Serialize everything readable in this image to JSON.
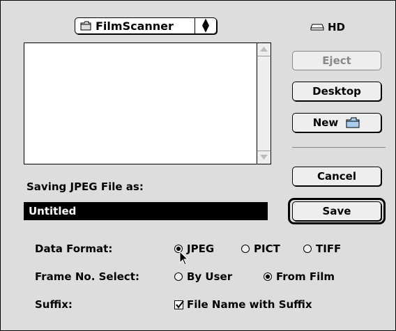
{
  "folder_popup": {
    "label": "FilmScanner",
    "icon": "folder-icon",
    "arrows_icon": "up-down-arrows-icon"
  },
  "volume": {
    "label": "HD",
    "icon": "hard-disk-icon"
  },
  "file_list": {
    "items": []
  },
  "buttons": {
    "eject": "Eject",
    "desktop": "Desktop",
    "new": "New",
    "cancel": "Cancel",
    "save": "Save"
  },
  "filename": {
    "label": "Saving JPEG File as:",
    "value": "Untitled"
  },
  "options": {
    "data_format": {
      "label": "Data Format:",
      "choices": [
        {
          "label": "JPEG",
          "selected": true
        },
        {
          "label": "PICT",
          "selected": false
        },
        {
          "label": "TIFF",
          "selected": false
        }
      ]
    },
    "frame_select": {
      "label": "Frame No. Select:",
      "choices": [
        {
          "label": "By User",
          "selected": false
        },
        {
          "label": "From Film",
          "selected": true
        }
      ]
    },
    "suffix": {
      "label": "Suffix:",
      "checkbox_label": "File Name with Suffix",
      "checked": true
    }
  },
  "colors": {
    "dialog_bg": "#dddddd",
    "selection_bg": "#000000",
    "disabled_text": "#888888"
  }
}
